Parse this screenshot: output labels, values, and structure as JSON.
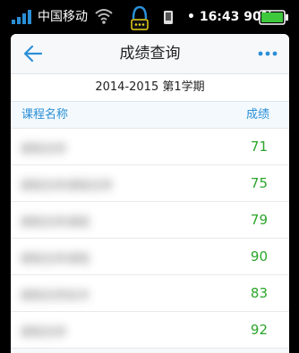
{
  "status_bar": {
    "carrier": "中国移动",
    "time": "16:43",
    "battery": "90%"
  },
  "nav": {
    "title": "成绩查询",
    "back_icon": "arrow-left-icon",
    "more_icon": "more-dots-icon"
  },
  "term": "2014-2015 第1学期",
  "list_header": {
    "course": "课程名称",
    "score": "成绩"
  },
  "grades": [
    {
      "course": "课程名称",
      "score": "71"
    },
    {
      "course": "课程名称课程名称",
      "score": "75"
    },
    {
      "course": "课程名称课程",
      "score": "79"
    },
    {
      "course": "课程名称课程",
      "score": "90"
    },
    {
      "course": "课程名称技术",
      "score": "83"
    },
    {
      "course": "课程名称",
      "score": "92"
    }
  ],
  "colors": {
    "accent": "#2b8fd6",
    "score": "#2aa52a",
    "battery": "#3ec83e"
  }
}
